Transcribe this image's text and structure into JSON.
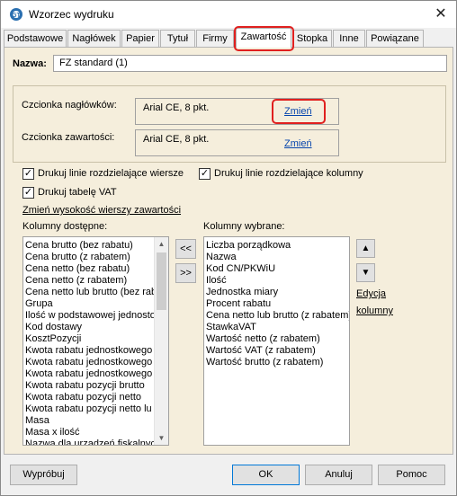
{
  "window": {
    "title": "Wzorzec wydruku",
    "close_glyph": "✕"
  },
  "tabs": [
    {
      "label": "Podstawowe"
    },
    {
      "label": "Nagłówek"
    },
    {
      "label": "Papier"
    },
    {
      "label": "Tytuł"
    },
    {
      "label": "Firmy"
    },
    {
      "label": "Zawartość"
    },
    {
      "label": "Stopka"
    },
    {
      "label": "Inne"
    },
    {
      "label": "Powiązane"
    }
  ],
  "active_tab": "Zawartość",
  "highlight_color": "#e0201f",
  "name_field": {
    "label": "Nazwa:",
    "value": "FZ standard (1)"
  },
  "header_font": {
    "label": "Czcionka nagłówków:",
    "value": "Arial CE, 8 pkt.",
    "change_label": "Zmień"
  },
  "content_font": {
    "label": "Czcionka zawartości:",
    "value": "Arial CE, 8 pkt.",
    "change_label": "Zmień"
  },
  "options": {
    "row_lines": {
      "label": "Drukuj linie rozdzielające wiersze",
      "checked": true
    },
    "col_lines": {
      "label": "Drukuj linie rozdzielające kolumny",
      "checked": true
    },
    "vat_table": {
      "label": "Drukuj tabelę VAT",
      "checked": true
    },
    "check_glyph": "✓"
  },
  "row_height_link": "Zmień wysokość wierszy zawartości",
  "available_columns": {
    "label": "Kolumny dostępne:",
    "items": [
      "Cena brutto (bez rabatu)",
      "Cena brutto (z rabatem)",
      "Cena netto (bez rabatu)",
      "Cena netto (z rabatem)",
      "Cena netto lub brutto (bez rab",
      "Grupa",
      "Ilość w podstawowej jednosto",
      "Kod dostawy",
      "KosztPozycji",
      "Kwota rabatu jednostkowego",
      "Kwota rabatu jednostkowego",
      "Kwota rabatu jednostkowego",
      "Kwota rabatu pozycji brutto",
      "Kwota rabatu pozycji netto",
      "Kwota rabatu pozycji netto lu",
      "Masa",
      "Masa x ilość",
      "Nazwa dla urządzeń fiskalnych"
    ]
  },
  "selected_columns": {
    "label": "Kolumny wybrane:",
    "items": [
      "Liczba porządkowa",
      "Nazwa",
      "Kod CN/PKWiU",
      "Ilość",
      "Jednostka miary",
      "Procent rabatu",
      "Cena netto lub brutto (z rabatem)",
      "StawkaVAT",
      "Wartość netto (z rabatem)",
      "Wartość VAT (z rabatem)",
      "Wartość brutto (z rabatem)"
    ]
  },
  "move_buttons": {
    "remove": "<<",
    "add": ">>"
  },
  "order_buttons": {
    "up": "▲",
    "down": "▼"
  },
  "edit_columns_link": {
    "line1": "Edycja",
    "line2": "kolumny"
  },
  "scroll": {
    "up": "▲",
    "down": "▼"
  },
  "footer": {
    "preview": "Wypróbuj",
    "ok": "OK",
    "cancel": "Anuluj",
    "help": "Pomoc"
  }
}
